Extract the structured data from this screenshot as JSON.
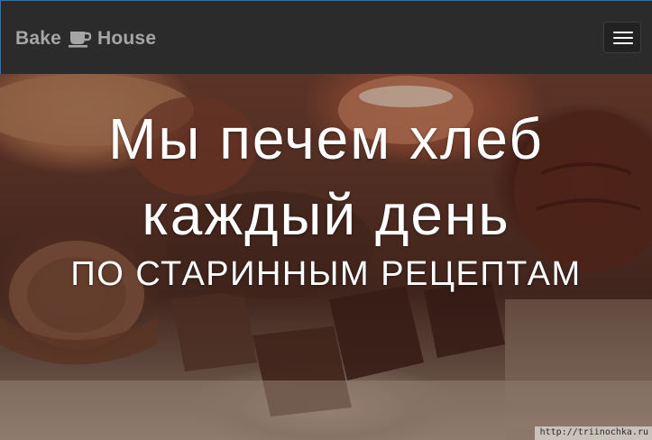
{
  "navbar": {
    "brand_part1": "Bake",
    "brand_icon": "coffee-cup-icon",
    "brand_part2": "House",
    "toggler_icon": "hamburger-menu-icon",
    "background_color": "#2b2b2b",
    "brand_color": "#a6a6a6"
  },
  "hero": {
    "title_line1": "Мы печем хлеб",
    "title_line2": "каждый день",
    "subtitle": "ПО СТАРИННЫМ РЕЦЕПТАМ",
    "watermark": "http://triinochka.ru",
    "text_color": "#ffffff"
  }
}
